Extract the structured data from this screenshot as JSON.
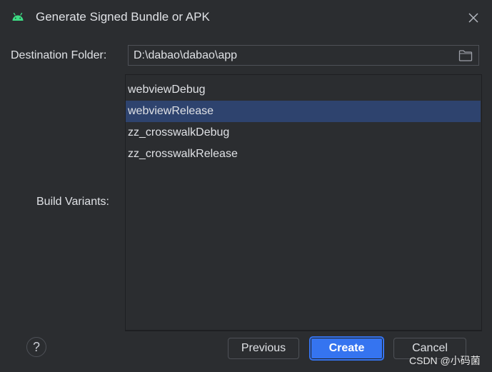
{
  "dialog": {
    "title": "Generate Signed Bundle or APK",
    "icon": "android-icon",
    "close_icon": "close-icon"
  },
  "destination": {
    "label": "Destination Folder:",
    "value": "D:\\dabao\\dabao\\app",
    "browse_icon": "folder-icon"
  },
  "build_variants": {
    "label": "Build Variants:",
    "items": [
      {
        "label": "webviewDebug",
        "selected": false
      },
      {
        "label": "webviewRelease",
        "selected": true
      },
      {
        "label": "zz_crosswalkDebug",
        "selected": false
      },
      {
        "label": "zz_crosswalkRelease",
        "selected": false
      }
    ]
  },
  "footer": {
    "help_label": "?",
    "previous_label": "Previous",
    "create_label": "Create",
    "cancel_label": "Cancel"
  },
  "watermark": "CSDN @小码菌",
  "colors": {
    "background": "#2b2d30",
    "accent": "#3574f0",
    "selection": "#2e436e",
    "android_green": "#3ddc84"
  }
}
